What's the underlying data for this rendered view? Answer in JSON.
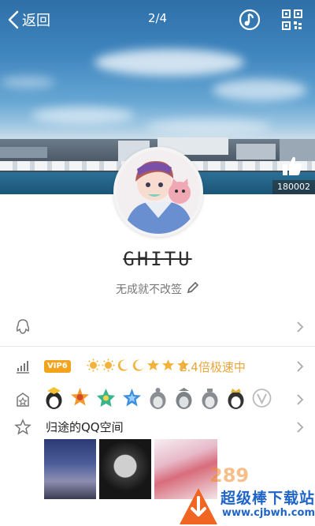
{
  "header": {
    "back_label": "返回",
    "page_indicator": "2/4",
    "like_count": "180002"
  },
  "profile": {
    "nickname": "GHITU",
    "signature": "无成就不改签"
  },
  "vip_row": {
    "vip_tag": "VIP6",
    "speed_text": "2.4倍极速中"
  },
  "space_row": {
    "title": "归途的QQ空间"
  },
  "watermark": {
    "brand": "超级棒下载站",
    "url": "www.cjbwh.com"
  },
  "icons": {
    "back": "chevron-left-icon",
    "music": "music-note-icon",
    "qr": "qr-code-icon",
    "like": "thumbs-up-icon",
    "edit": "pencil-icon",
    "qq": "penguin-icon",
    "level": "level-chart-icon",
    "badge": "medal-icon",
    "star": "star-icon"
  },
  "colors": {
    "accent_orange": "#e8a53a",
    "vip_orange": "#f3a31c",
    "watermark_blue": "#1f64c8"
  }
}
